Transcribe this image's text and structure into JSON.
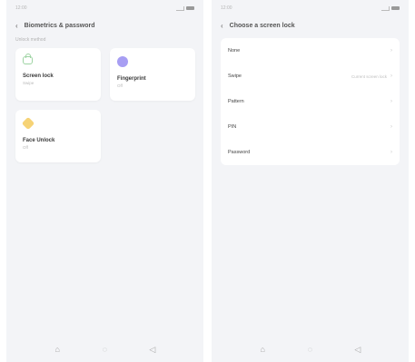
{
  "left": {
    "status_time": "12:00",
    "title": "Biometrics & password",
    "section_label": "Unlock method",
    "cards": [
      {
        "title": "Screen lock",
        "subtitle": "Swipe",
        "icon": "lock-icon"
      },
      {
        "title": "Fingerprint",
        "subtitle": "Off",
        "icon": "fingerprint-icon"
      },
      {
        "title": "Face Unlock",
        "subtitle": "Off",
        "icon": "face-icon"
      }
    ]
  },
  "right": {
    "status_time": "12:00",
    "title": "Choose a screen lock",
    "options": [
      {
        "label": "None",
        "value": ""
      },
      {
        "label": "Swipe",
        "value": "Current screen lock"
      },
      {
        "label": "Pattern",
        "value": ""
      },
      {
        "label": "PIN",
        "value": ""
      },
      {
        "label": "Password",
        "value": ""
      }
    ]
  },
  "nav_icons": [
    "home-icon",
    "apps-icon",
    "back-icon"
  ]
}
